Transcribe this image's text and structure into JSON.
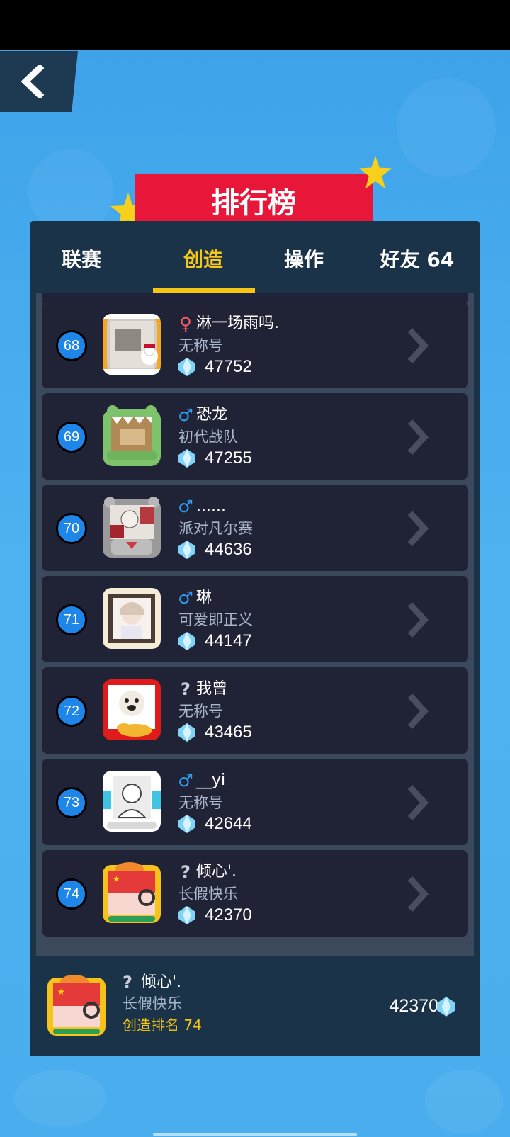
{
  "screen_title": "排行榜",
  "tabs": [
    {
      "label": "联赛"
    },
    {
      "label": "创造"
    },
    {
      "label": "操作"
    },
    {
      "label": "好友 64"
    }
  ],
  "active_tab": "创造",
  "leaderboard": [
    {
      "rank": "68",
      "gender": "♀",
      "name": "淋一场雨吗.",
      "title": "无称号",
      "score": "47752"
    },
    {
      "rank": "69",
      "gender": "♂",
      "name": "恐龙",
      "title": "初代战队",
      "score": "47255"
    },
    {
      "rank": "70",
      "gender": "♂",
      "name": "......",
      "title": "派对凡尔赛",
      "score": "44636"
    },
    {
      "rank": "71",
      "gender": "♂",
      "name": "琳",
      "title": "可爱即正义",
      "score": "44147"
    },
    {
      "rank": "72",
      "gender": "?",
      "name": "我曾",
      "title": "无称号",
      "score": "43465"
    },
    {
      "rank": "73",
      "gender": "♂",
      "name": "__yi",
      "title": "无称号",
      "score": "42644"
    },
    {
      "rank": "74",
      "gender": "?",
      "name": "倾心'.",
      "title": "长假快乐",
      "score": "42370"
    }
  ],
  "my_entry": {
    "gender": "?",
    "name": "倾心'.",
    "title": "长假快乐",
    "rank_text": "创造排名 74",
    "score": "42370"
  },
  "colors": {
    "background": "#47a9ec",
    "panel": "#1b3348",
    "row": "#202236",
    "accent_yellow": "#f7c614",
    "banner_red": "#e8173a",
    "rank_blue": "#1d86e8"
  },
  "icons": {
    "back": "back-arrow-icon",
    "score": "diamond-icon",
    "row_action": "chevron-right-icon"
  }
}
